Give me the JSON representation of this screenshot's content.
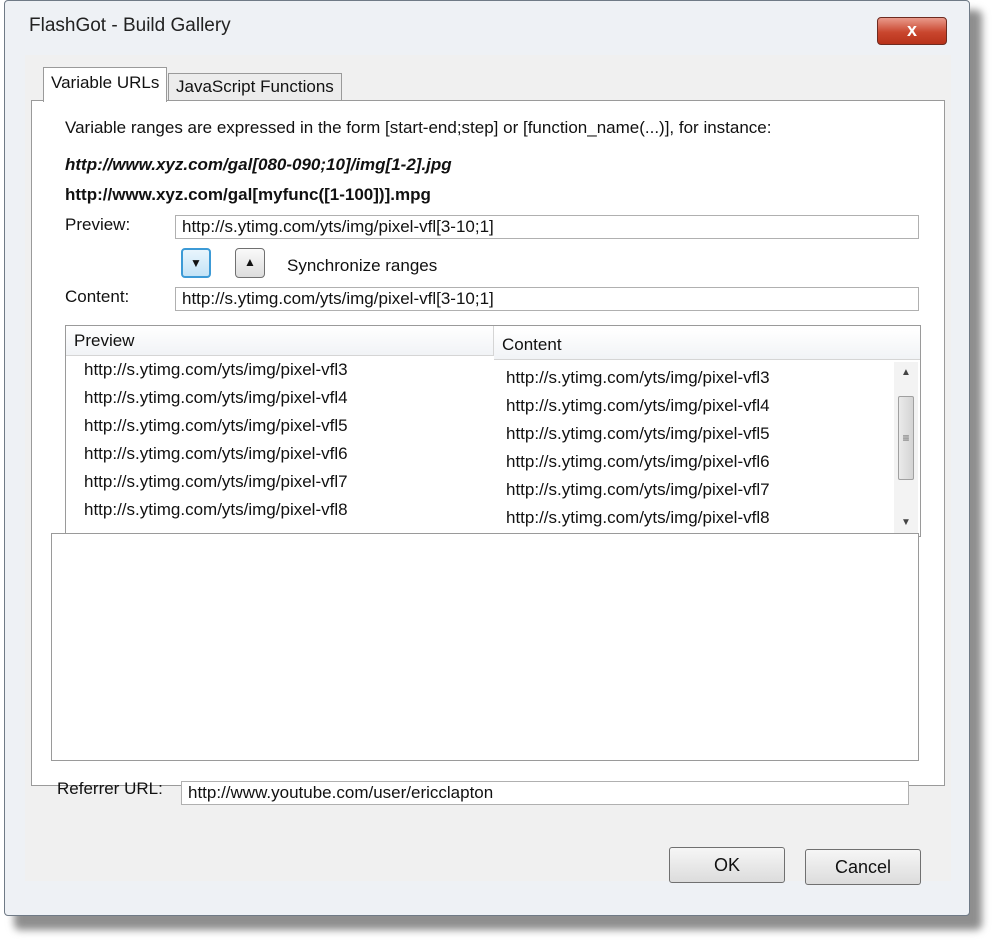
{
  "window": {
    "title": "FlashGot - Build Gallery",
    "close_label": "x"
  },
  "tabs": [
    {
      "label": "Variable URLs",
      "active": true
    },
    {
      "label": "JavaScript Functions",
      "active": false
    }
  ],
  "intro": {
    "text": "Variable ranges are expressed in the form [start-end;step] or [function_name(...)], for instance:",
    "example1": "http://www.xyz.com/gal[080-090;10]/img[1-2].jpg",
    "example2": "http://www.xyz.com/gal[myfunc([1-100])].mpg"
  },
  "preview": {
    "label": "Preview:",
    "value": "http://s.ytimg.com/yts/img/pixel-vfl[3-10;1]"
  },
  "sync": {
    "label": "Synchronize ranges",
    "down_icon": "▼",
    "up_icon": "▲"
  },
  "content": {
    "label": "Content:",
    "value": "http://s.ytimg.com/yts/img/pixel-vfl[3-10;1]"
  },
  "list": {
    "columns": [
      "Preview",
      "Content"
    ],
    "rows": [
      [
        "http://s.ytimg.com/yts/img/pixel-vfl3",
        "http://s.ytimg.com/yts/img/pixel-vfl3"
      ],
      [
        "http://s.ytimg.com/yts/img/pixel-vfl4",
        "http://s.ytimg.com/yts/img/pixel-vfl4"
      ],
      [
        "http://s.ytimg.com/yts/img/pixel-vfl5",
        "http://s.ytimg.com/yts/img/pixel-vfl5"
      ],
      [
        "http://s.ytimg.com/yts/img/pixel-vfl6",
        "http://s.ytimg.com/yts/img/pixel-vfl6"
      ],
      [
        "http://s.ytimg.com/yts/img/pixel-vfl7",
        "http://s.ytimg.com/yts/img/pixel-vfl7"
      ],
      [
        "http://s.ytimg.com/yts/img/pixel-vfl8",
        "http://s.ytimg.com/yts/img/pixel-vfl8"
      ]
    ]
  },
  "referrer": {
    "label": "Referrer URL:",
    "value": "http://www.youtube.com/user/ericclapton"
  },
  "buttons": {
    "ok": "OK",
    "cancel": "Cancel"
  },
  "colors": {
    "close": "#c9462e",
    "focus": "#3c9ad6"
  }
}
